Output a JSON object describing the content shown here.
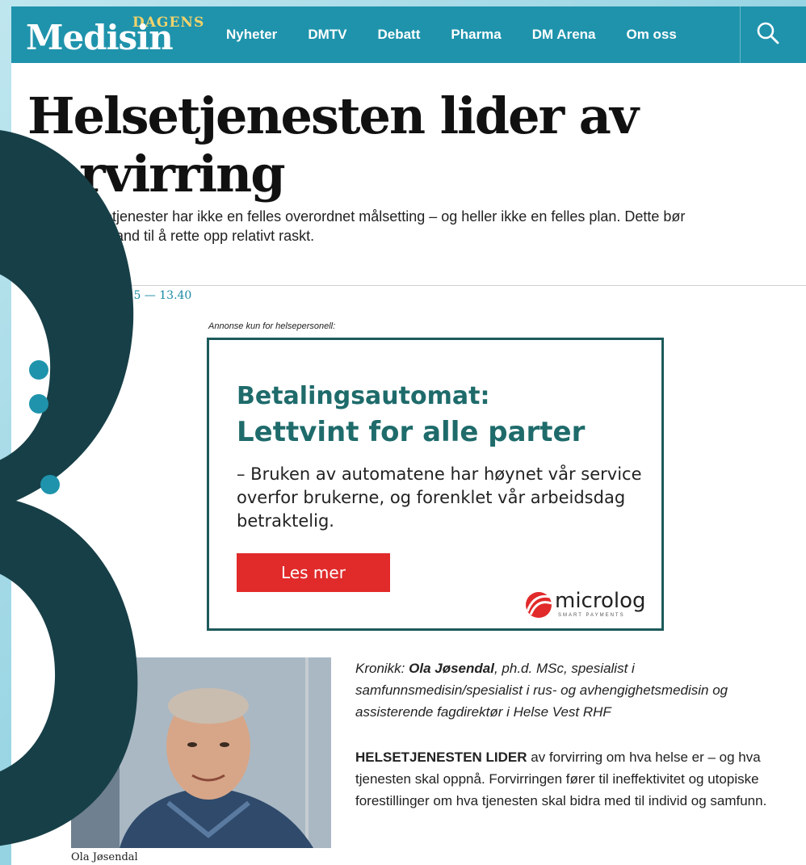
{
  "header": {
    "logo_small": "DAGENS",
    "logo_big": "Medisin",
    "nav": [
      "Nyheter",
      "DMTV",
      "Debatt",
      "Pharma",
      "DM Arena",
      "Om oss"
    ],
    "search_icon": "search-icon"
  },
  "article": {
    "headline_line1": "Helsetjenesten lider av",
    "headline_line2": "forvirring",
    "lead_line1": "helsetjenester har ikke en felles overordnet målsetting – og heller ikke en felles plan. Dette bør",
    "lead_line2": "i stand til å rette opp relativt raskt.",
    "date": "08-25 — 13.40"
  },
  "ad": {
    "label": "Annonse kun for helsepersonell:",
    "heading1": "Betalingsautomat:",
    "heading2": "Lettvint for alle parter",
    "body": "– Bruken av automatene har høynet vår service overfor brukerne, og forenklet vår arbeidsdag betraktelig.",
    "button": "Les mer",
    "brand": "microlog",
    "brand_sub": "SMART PAYMENTS",
    "colors": {
      "border": "#1d5a5a",
      "heading": "#1f6b6b",
      "button": "#e12a2a"
    }
  },
  "photo": {
    "caption": "Ola Jøsendal"
  },
  "byline": {
    "prefix": "Kronikk: ",
    "name": "Ola Jøsendal",
    "rest": ", ph.d. MSc, spesialist i samfunnsmedisin/spesialist i rus- og avhengighetsmedisin og assisterende fagdirektør i Helse Vest RHF"
  },
  "body": {
    "lead_caps": "HELSETJENESTEN LIDER",
    "text": " av forvirring om hva helse er – og hva tjenesten skal oppnå. Forvirringen fører til ineffektivitet og utopiske forestillinger om hva tjenesten skal bidra med til individ og samfunn."
  },
  "colors": {
    "topbar": "#1f93ac",
    "logo_accent": "#f2d36b",
    "overlay_numeral": "#173f47",
    "date": "#1a8aa4"
  }
}
